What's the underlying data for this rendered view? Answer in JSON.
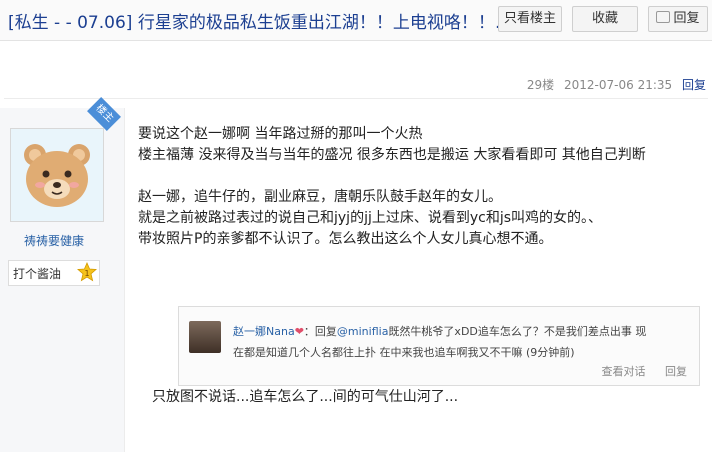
{
  "header": {
    "title": "[私生 - - 07.06] 行星家的极品私生饭重出江湖！！上电视咯！！…",
    "buttons": {
      "only_op": "只看楼主",
      "favorite": "收藏",
      "reply": "回复"
    }
  },
  "post_meta": {
    "floor": "29楼",
    "datetime": "2012-07-06 21:35",
    "reply": "回复"
  },
  "author": {
    "badge": "楼主",
    "name": "祷祷要健康",
    "rank_label": "打个酱油",
    "rank_level": "1"
  },
  "content": {
    "text": "要说这个赵一娜啊 当年路过掰的那叫一个火热\n楼主福薄 没来得及当与当年的盛况 很多东西也是搬运 大家看看即可 其他自己判断\n\n赵一娜，追牛仔的，副业麻豆，唐朝乐队鼓手赵年的女儿。\n就是之前被路过表过的说自己和jyj的jj上过床、说看到yc和js叫鸡的女的。、\n带妆照片P的亲爹都不认识了。怎么教出这么个人女儿真心想不通。"
  },
  "quote": {
    "user": "赵一娜Nana",
    "heart": "❤",
    "line1_prefix": "：回复",
    "at_user": "@miniflia",
    "line1_rest": "既然牛桃爷了xDD追车怎么了？不是我们差点出事 现",
    "line2": "在都是知道几个人名都往上扑 在中来我也追车啊我又不干嘛 (9分钟前)",
    "actions": {
      "view": "查看对话",
      "reply": "回复"
    }
  },
  "footer_text": "只放图不说话...追车怎么了...间的可气仕山河了..."
}
